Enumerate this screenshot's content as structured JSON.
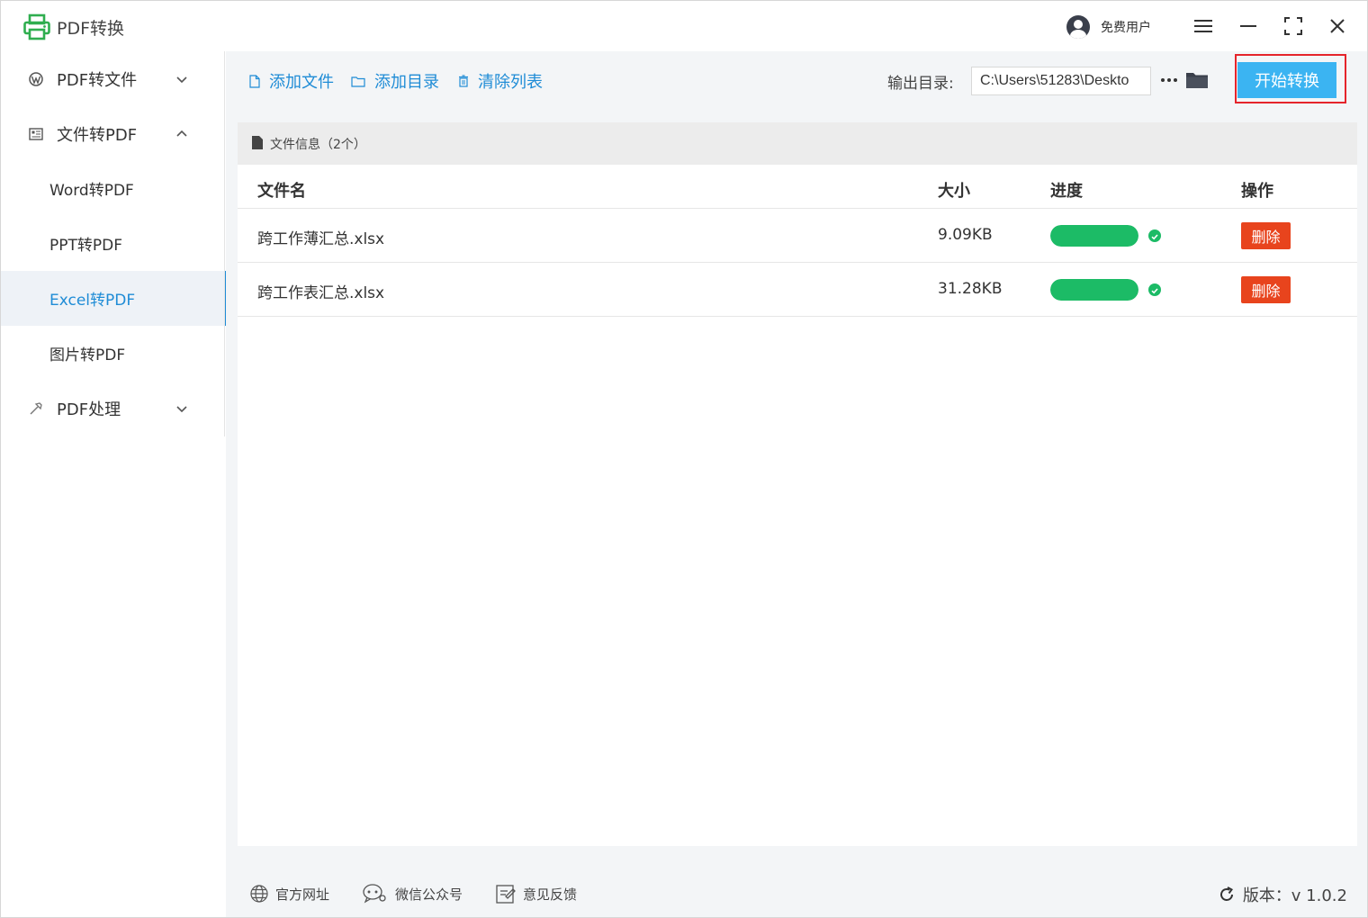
{
  "app": {
    "title": "PDF转换"
  },
  "user": {
    "name": "免费用户"
  },
  "sidebar": {
    "groups": [
      {
        "label": "PDF转文件",
        "icon": "wordpress-icon",
        "expanded": false
      },
      {
        "label": "文件转PDF",
        "icon": "document-list-icon",
        "expanded": true
      },
      {
        "label": "PDF处理",
        "icon": "hammer-icon",
        "expanded": false
      }
    ],
    "sub_items": [
      {
        "label": "Word转PDF",
        "active": false
      },
      {
        "label": "PPT转PDF",
        "active": false
      },
      {
        "label": "Excel转PDF",
        "active": true
      },
      {
        "label": "图片转PDF",
        "active": false
      }
    ]
  },
  "toolbar": {
    "add_file": "添加文件",
    "add_dir": "添加目录",
    "clear_list": "清除列表",
    "output_label": "输出目录:",
    "output_path": "C:\\Users\\51283\\Deskto",
    "start": "开始转换"
  },
  "files": {
    "header": "文件信息（2个）",
    "columns": {
      "name": "文件名",
      "size": "大小",
      "progress": "进度",
      "action": "操作"
    },
    "rows": [
      {
        "name": "跨工作薄汇总.xlsx",
        "size": "9.09KB",
        "progress": 1.0,
        "action": "删除"
      },
      {
        "name": "跨工作表汇总.xlsx",
        "size": "31.28KB",
        "progress": 1.0,
        "action": "删除"
      }
    ]
  },
  "footer": {
    "website": "官方网址",
    "wechat": "微信公众号",
    "feedback": "意见反馈",
    "version": "版本：v 1.0.2"
  },
  "colors": {
    "accent": "#1f8cd6",
    "start_button": "#3bb4f2",
    "progress": "#1cbb66",
    "delete": "#e8441d",
    "highlight": "#e5242b"
  }
}
